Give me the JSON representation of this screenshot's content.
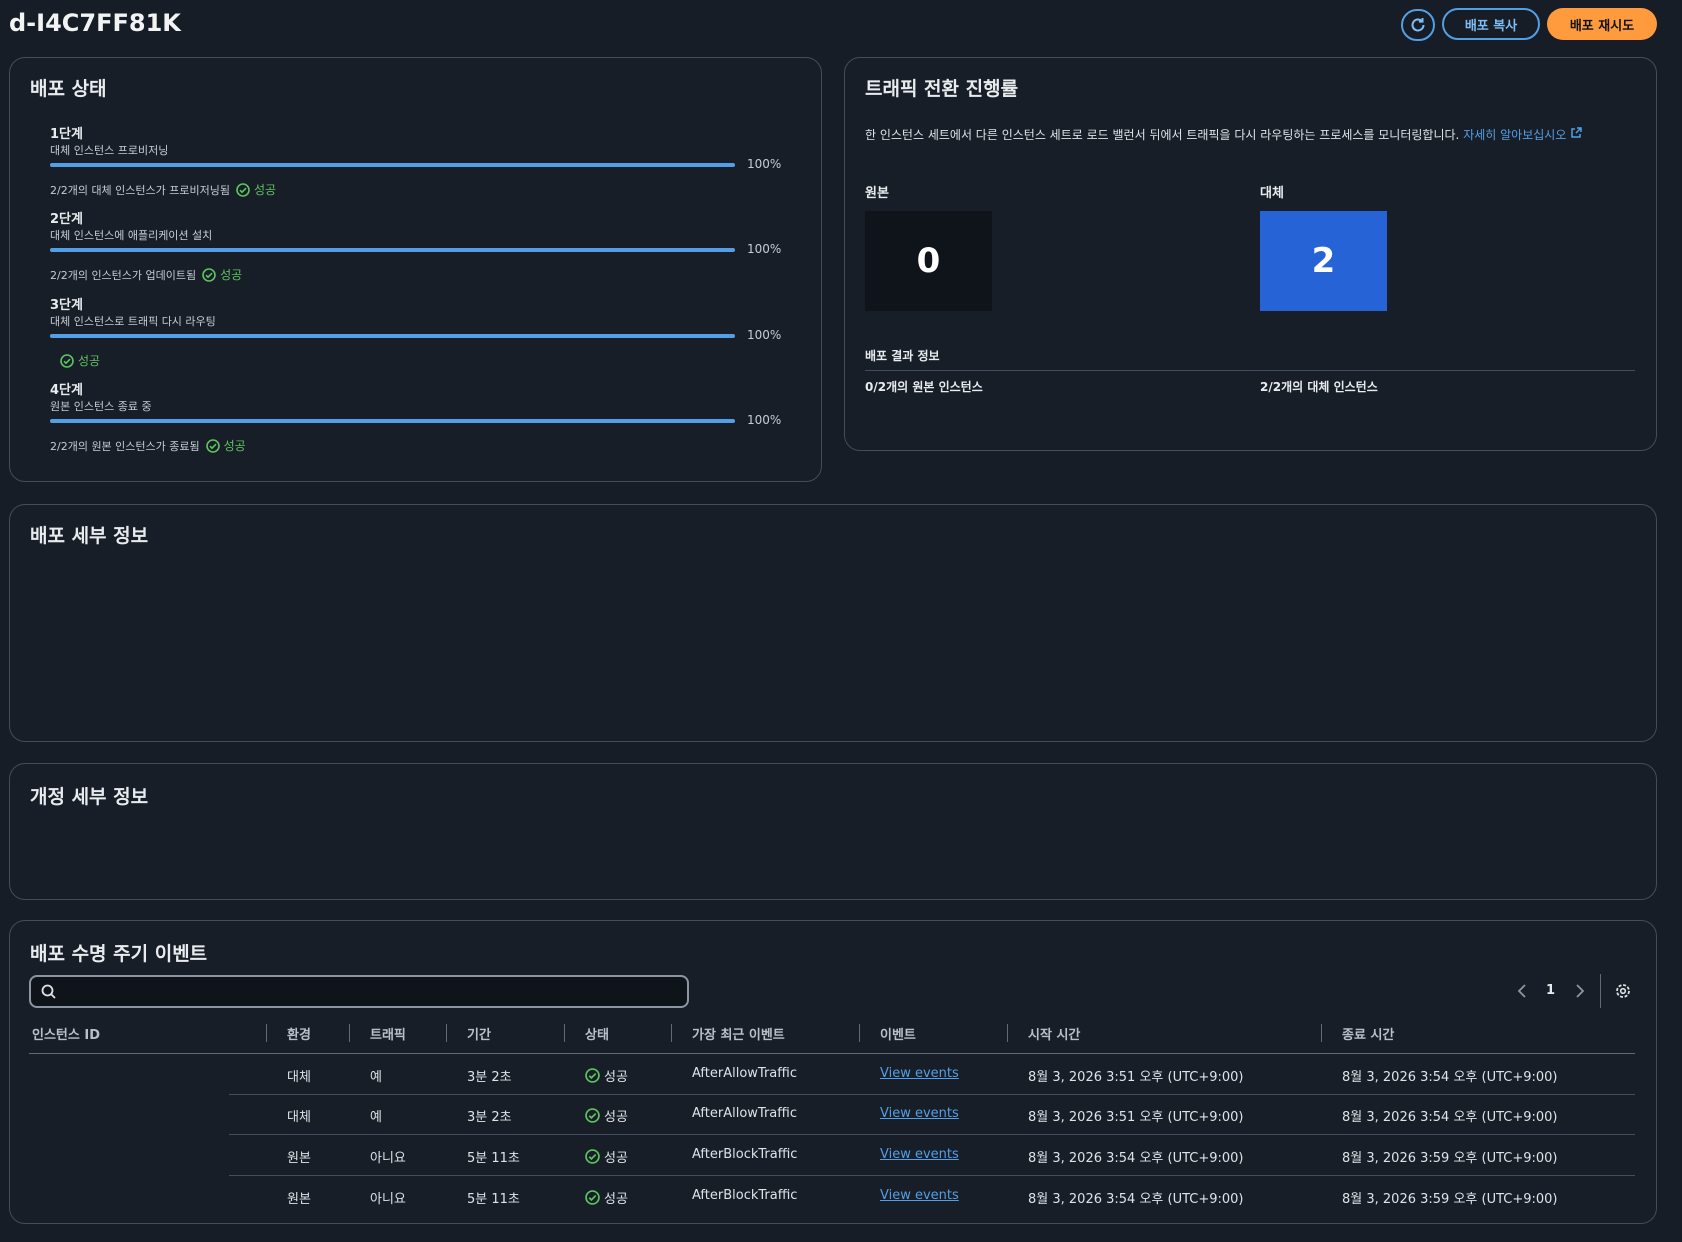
{
  "header": {
    "title": "d-I4C7FF81K",
    "refresh_icon": "refresh-icon",
    "copy_button": "배포 복사",
    "retry_button": "배포 재시도"
  },
  "deploy_status": {
    "title": "배포 상태",
    "success_label": "성공",
    "stages": [
      {
        "name": "1단계",
        "desc": "대체 인스턴스 프로비저닝",
        "progress": 100,
        "progress_label": "100%",
        "foot": "2/2개의 대체 인스턴스가 프로비저닝됨"
      },
      {
        "name": "2단계",
        "desc": "대체 인스턴스에 애플리케이션 설치",
        "progress": 100,
        "progress_label": "100%",
        "foot": "2/2개의 인스턴스가 업데이트됨"
      },
      {
        "name": "3단계",
        "desc": "대체 인스턴스로 트래픽 다시 라우팅",
        "progress": 100,
        "progress_label": "100%",
        "foot": ""
      },
      {
        "name": "4단계",
        "desc": "원본 인스턴스 종료 중",
        "progress": 100,
        "progress_label": "100%",
        "foot": "2/2개의 원본 인스턴스가 종료됨"
      }
    ]
  },
  "traffic": {
    "title": "트래픽 전환 진행률",
    "description": "한 인스턴스 세트에서 다른 인스턴스 세트로 로드 밸런서 뒤에서 트래픽을 다시 라우팅하는 프로세스를 모니터링합니다.",
    "learn_more": "자세히 알아보십시오",
    "original_label": "원본",
    "original_count": "0",
    "replacement_label": "대체",
    "replacement_count": "2",
    "result_title": "배포 결과 정보",
    "original_result": "0/2개의 원본 인스턴스",
    "replacement_result": "2/2개의 대체 인스턴스",
    "colors": {
      "original_box": "#0f141a",
      "replacement_box": "#2563d6"
    }
  },
  "deploy_details": {
    "title": "배포 세부 정보"
  },
  "revision_details": {
    "title": "개정 세부 정보"
  },
  "lifecycle": {
    "title": "배포 수명 주기 이벤트",
    "search_placeholder": "",
    "page": "1",
    "columns": [
      "인스턴스 ID",
      "환경",
      "트래픽",
      "기간",
      "상태",
      "가장 최근 이벤트",
      "이벤트",
      "시작 시간",
      "종료 시간"
    ],
    "rows": [
      {
        "instance": "",
        "env": "대체",
        "traffic": "예",
        "duration": "3분 2초",
        "status": "성공",
        "latest": "AfterAllowTraffic",
        "events": "View events",
        "start": "8월 3, 2026 3:51 오후 (UTC+9:00)",
        "end": "8월 3, 2026 3:54 오후 (UTC+9:00)"
      },
      {
        "instance": "",
        "env": "대체",
        "traffic": "예",
        "duration": "3분 2초",
        "status": "성공",
        "latest": "AfterAllowTraffic",
        "events": "View events",
        "start": "8월 3, 2026 3:51 오후 (UTC+9:00)",
        "end": "8월 3, 2026 3:54 오후 (UTC+9:00)"
      },
      {
        "instance": "",
        "env": "원본",
        "traffic": "아니요",
        "duration": "5분 11초",
        "status": "성공",
        "latest": "AfterBlockTraffic",
        "events": "View events",
        "start": "8월 3, 2026 3:54 오후 (UTC+9:00)",
        "end": "8월 3, 2026 3:59 오후 (UTC+9:00)"
      },
      {
        "instance": "",
        "env": "원본",
        "traffic": "아니요",
        "duration": "5분 11초",
        "status": "성공",
        "latest": "AfterBlockTraffic",
        "events": "View events",
        "start": "8월 3, 2026 3:54 오후 (UTC+9:00)",
        "end": "8월 3, 2026 3:59 오후 (UTC+9:00)"
      }
    ]
  }
}
